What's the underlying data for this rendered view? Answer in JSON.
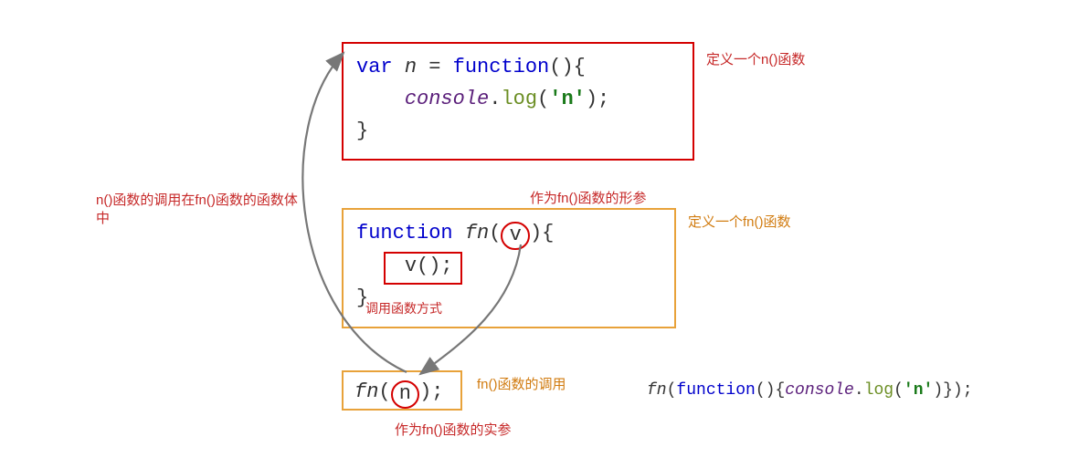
{
  "annotations": {
    "define_n": "定义一个n()函数",
    "n_call_in_fn": "n()函数的调用在fn()函数的函数体中",
    "fn_param": "作为fn()函数的形参",
    "define_fn": "定义一个fn()函数",
    "call_fn_way": "调用函数方式",
    "fn_invoke": "fn()函数的调用",
    "fn_arg": "作为fn()函数的实参"
  },
  "code": {
    "block1": {
      "kw_var": "var",
      "name": "n",
      "eq": " = ",
      "kw_function": "function",
      "after_fn": "(){",
      "indent": "    ",
      "obj": "console",
      "dot": ".",
      "method": "log",
      "open": "(",
      "str": "'n'",
      "close_stmt": ");",
      "close_brace": "}"
    },
    "block2": {
      "kw_function": "function",
      "fn_name": "fn",
      "open": "(",
      "param": "v",
      "after_param": "){",
      "indent": "    ",
      "call": "v();",
      "close_brace": "}"
    },
    "block3": {
      "fn_name": "fn",
      "open": "(",
      "arg": "n",
      "close": ");"
    },
    "inline": {
      "fn_name": "fn",
      "open": "(",
      "kw_function": "function",
      "after_fn": "(){",
      "obj": "console",
      "dot": ".",
      "method": "log",
      "str_open": "(",
      "str": "'n'",
      "str_close": ")}",
      "end": ");"
    }
  }
}
